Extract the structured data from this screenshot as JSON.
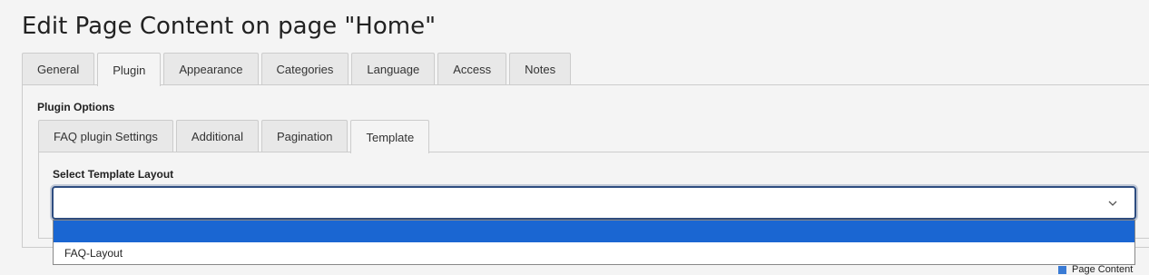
{
  "page": {
    "title": "Edit Page Content on page \"Home\""
  },
  "outer_tabs": [
    {
      "label": "General"
    },
    {
      "label": "Plugin"
    },
    {
      "label": "Appearance"
    },
    {
      "label": "Categories"
    },
    {
      "label": "Language"
    },
    {
      "label": "Access"
    },
    {
      "label": "Notes"
    }
  ],
  "outer_active_tab": "Plugin",
  "plugin_options": {
    "section_label": "Plugin Options",
    "tabs": [
      {
        "label": "FAQ plugin Settings"
      },
      {
        "label": "Additional"
      },
      {
        "label": "Pagination"
      },
      {
        "label": "Template"
      }
    ],
    "active_tab": "Template"
  },
  "template": {
    "field_label": "Select Template Layout",
    "selected_value": "",
    "options": [
      {
        "label": "",
        "highlighted": true
      },
      {
        "label": "FAQ-Layout",
        "highlighted": false
      }
    ]
  },
  "footer_snippet": {
    "text": "Page Content"
  },
  "colors": {
    "focus_border": "#2e4d80",
    "option_highlight": "#1a66d2",
    "background": "#f4f4f4"
  }
}
